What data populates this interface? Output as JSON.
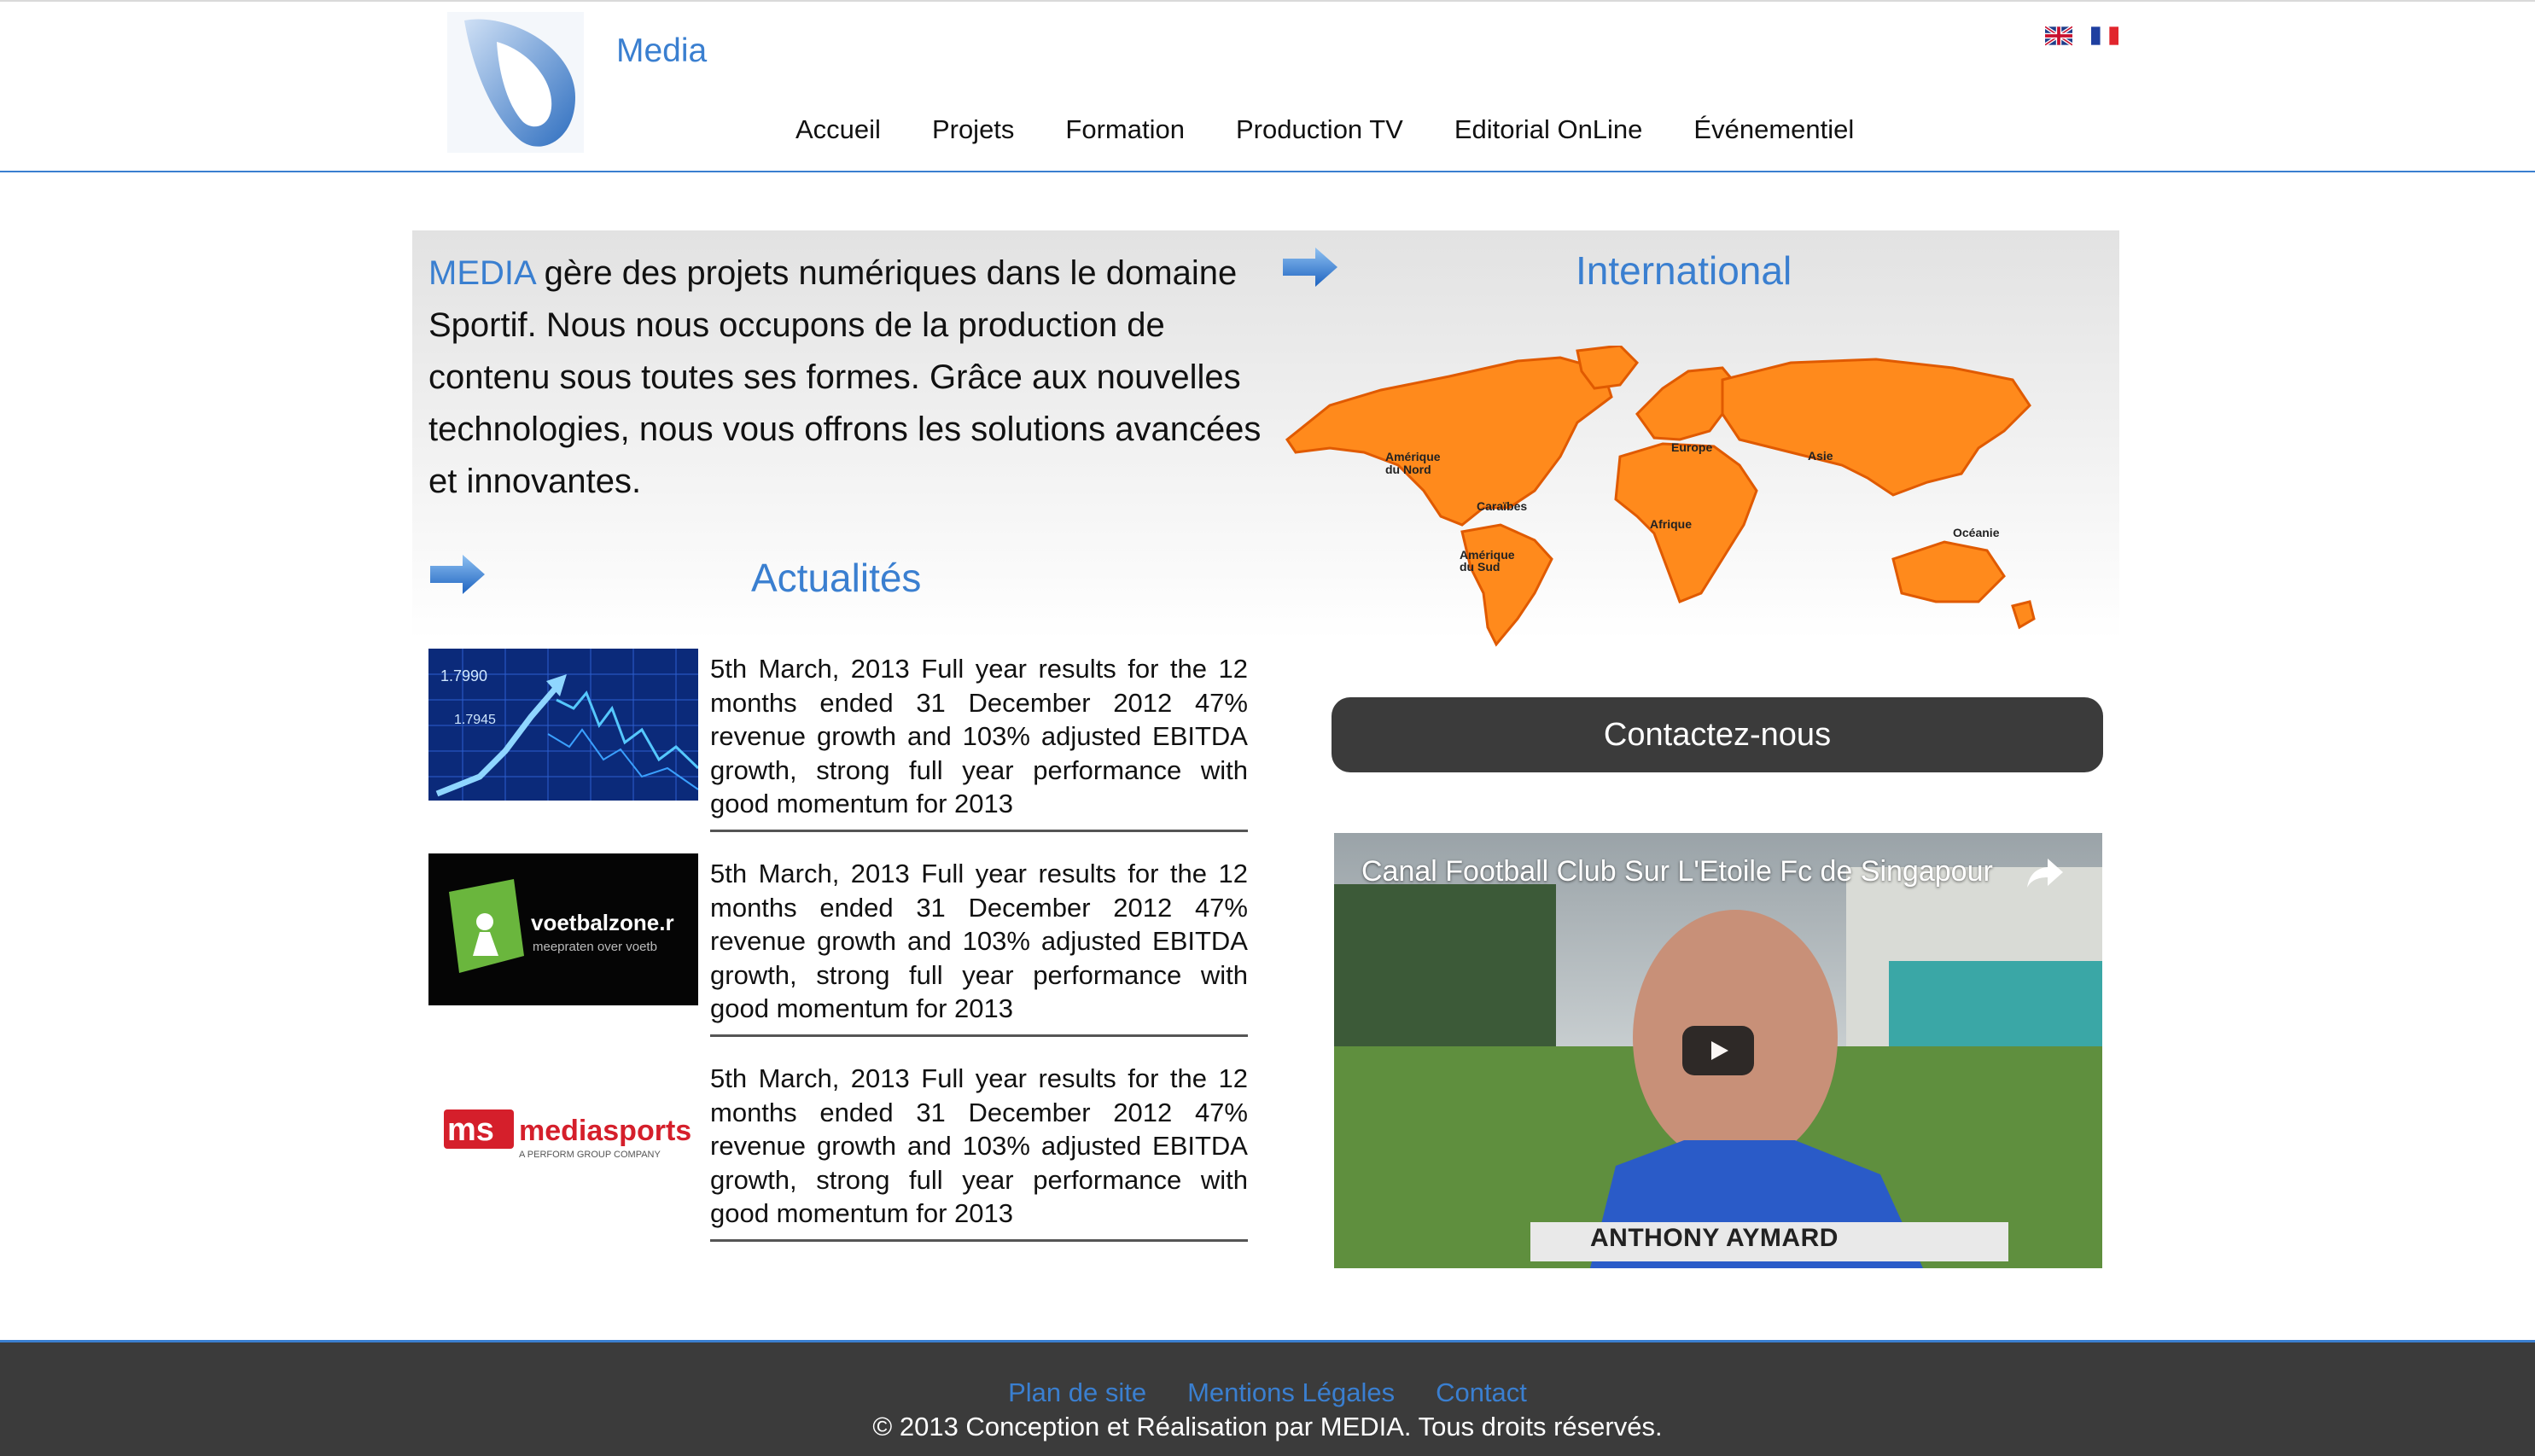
{
  "header": {
    "brand": "Media",
    "nav": [
      "Accueil",
      "Projets",
      "Formation",
      "Production TV",
      "Editorial OnLine",
      "Événementiel"
    ],
    "languages": [
      "en-flag-icon",
      "fr-flag-icon"
    ]
  },
  "intro": {
    "highlight": "MEDIA",
    "text": " gère des projets numériques dans le domaine Sportif. Nous nous occupons de la production de contenu sous toutes ses formes. Grâce aux nouvelles technologies, nous vous offrons les solutions avancées et innovantes."
  },
  "news": {
    "title": "Actualités",
    "items": [
      {
        "thumb": "stock-chart-image",
        "text": "5th March, 2013 Full year results for the 12 months ended 31 December 2012 47% revenue growth and 103% adjusted EBITDA growth, strong full year performance with good momentum for 2013"
      },
      {
        "thumb": "voetbalzone-logo",
        "text": "5th March, 2013 Full year results for the 12 months ended 31 December 2012 47% revenue growth and 103% adjusted EBITDA growth, strong full year performance with good momentum for 2013"
      },
      {
        "thumb": "mediasports-logo",
        "text": "5th March, 2013 Full year results for the 12 months ended 31 December 2012 47% revenue growth and 103% adjusted EBITDA growth, strong full year performance with good momentum for 2013"
      }
    ]
  },
  "thumbs": {
    "chart_labels": [
      "1.7990",
      "1.7945"
    ],
    "voetbalzone_name": "voetbalzone.r",
    "voetbalzone_tagline": "meepraten over voetb",
    "mediasports_mark": "ms",
    "mediasports_name": "mediasports",
    "mediasports_tagline": "A PERFORM GROUP COMPANY"
  },
  "international": {
    "title": "International",
    "regions": [
      "Amérique",
      "du Nord",
      "Caraïbes",
      "Amérique",
      "du Sud",
      "Europe",
      "Asie",
      "Afrique",
      "Océanie"
    ]
  },
  "contact_button": "Contactez-nous",
  "video": {
    "title": "Canal Football Club Sur L'Etoile Fc de Singapour",
    "caption": "ANTHONY AYMARD"
  },
  "footer": {
    "links": [
      "Plan de site",
      "Mentions Légales",
      "Contact"
    ],
    "copyright": "© 2013 Conception et Réalisation par MEDIA. Tous droits réservés."
  },
  "colors": {
    "accent": "#3a7fd0",
    "dark": "#3b3b3b",
    "map_orange": "#ff8a1c"
  }
}
